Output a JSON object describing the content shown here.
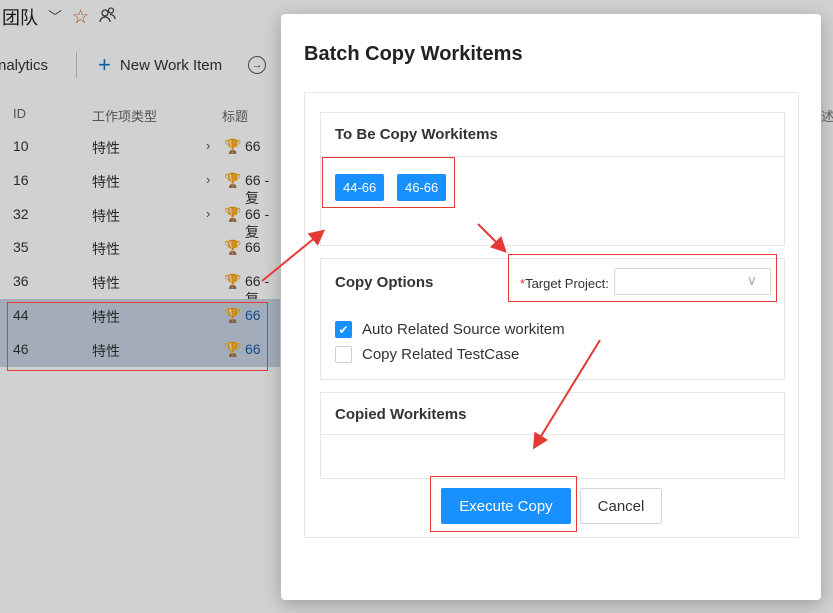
{
  "background": {
    "team_title": "团队",
    "toolbar": {
      "analytics_label": "nalytics",
      "new_work_item_label": "New Work Item"
    },
    "columns": {
      "id": "ID",
      "type": "工作项类型",
      "title": "标题"
    },
    "rows": [
      {
        "id": "10",
        "type": "特性",
        "expand": "›",
        "title": "66"
      },
      {
        "id": "16",
        "type": "特性",
        "expand": "›",
        "title": "66 - 复"
      },
      {
        "id": "32",
        "type": "特性",
        "expand": "›",
        "title": "66 - 复"
      },
      {
        "id": "35",
        "type": "特性",
        "expand": "",
        "title": "66"
      },
      {
        "id": "36",
        "type": "特性",
        "expand": "",
        "title": "66 - 复"
      },
      {
        "id": "44",
        "type": "特性",
        "expand": "",
        "title": "66"
      },
      {
        "id": "46",
        "type": "特性",
        "expand": "",
        "title": "66"
      }
    ],
    "right_edge_text": "述"
  },
  "dialog": {
    "title": "Batch Copy Workitems",
    "to_be_copy": {
      "heading": "To Be Copy Workitems",
      "items": [
        "44-66",
        "46-66"
      ]
    },
    "copy_options": {
      "heading": "Copy Options",
      "target_project_required_mark": "*",
      "target_project_label": "Target Project:",
      "target_project_value": "",
      "options": [
        {
          "label": "Auto Related Source workitem",
          "checked": true
        },
        {
          "label": "Copy Related TestCase",
          "checked": false
        }
      ]
    },
    "copied": {
      "heading": "Copied Workitems"
    },
    "execute_label": "Execute Copy",
    "cancel_label": "Cancel"
  },
  "colors": {
    "primary": "#1890ff",
    "annotation": "#e53935",
    "selection": "#c7d3e3"
  }
}
